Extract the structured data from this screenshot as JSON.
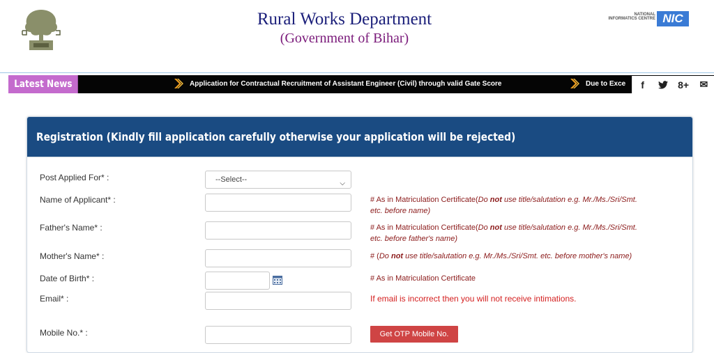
{
  "header": {
    "title": "Rural Works Department",
    "subtitle": "(Government of Bihar)",
    "emblem_icon": "bihar-emblem-icon",
    "nic": {
      "small_text": "NATIONAL INFORMATICS CENTRE",
      "badge": "NIC"
    }
  },
  "newsbar": {
    "label": "Latest News",
    "items": [
      "Application for Contractual Recruitment of Assistant Engineer (Civil) through valid Gate Score",
      "Due to Exce"
    ],
    "social": [
      "f",
      "↘",
      "8+",
      "✉"
    ]
  },
  "form": {
    "heading": "Registration (Kindly fill application carefully otherwise your application will be rejected)",
    "post_label": "Post Applied For* :",
    "post_selected": "--Select--",
    "name_label": "Name of Applicant* :",
    "name_note_a": "# As in Matriculation Certificate(",
    "name_note_b": "Do ",
    "name_note_c": "not",
    "name_note_d": " use title/salutation e.g. Mr./Ms./Sri/Smt.",
    "name_note_e": "etc. before name)",
    "father_label": "Father's Name* :",
    "father_note_a": "# As in Matriculation Certificate(",
    "father_note_b": "Do ",
    "father_note_c": "not",
    "father_note_d": " use title/salutation e.g. Mr./Ms./Sri/Smt.",
    "father_note_e": "etc. before father's name)",
    "mother_label": "Mother's Name* :",
    "mother_note_a": "# (",
    "mother_note_b": "Do ",
    "mother_note_c": "not",
    "mother_note_d": " use title/salutation e.g. Mr./Ms./Sri/Smt. etc. before mother's name)",
    "dob_label": "Date of Birth* :",
    "dob_note": "# As in Matriculation Certificate",
    "email_label": "Email* :",
    "email_note": "If email is incorrect then you will not receive intimations.",
    "mobile_label": "Mobile No.* :",
    "otp_button": "Get OTP Mobile No."
  }
}
